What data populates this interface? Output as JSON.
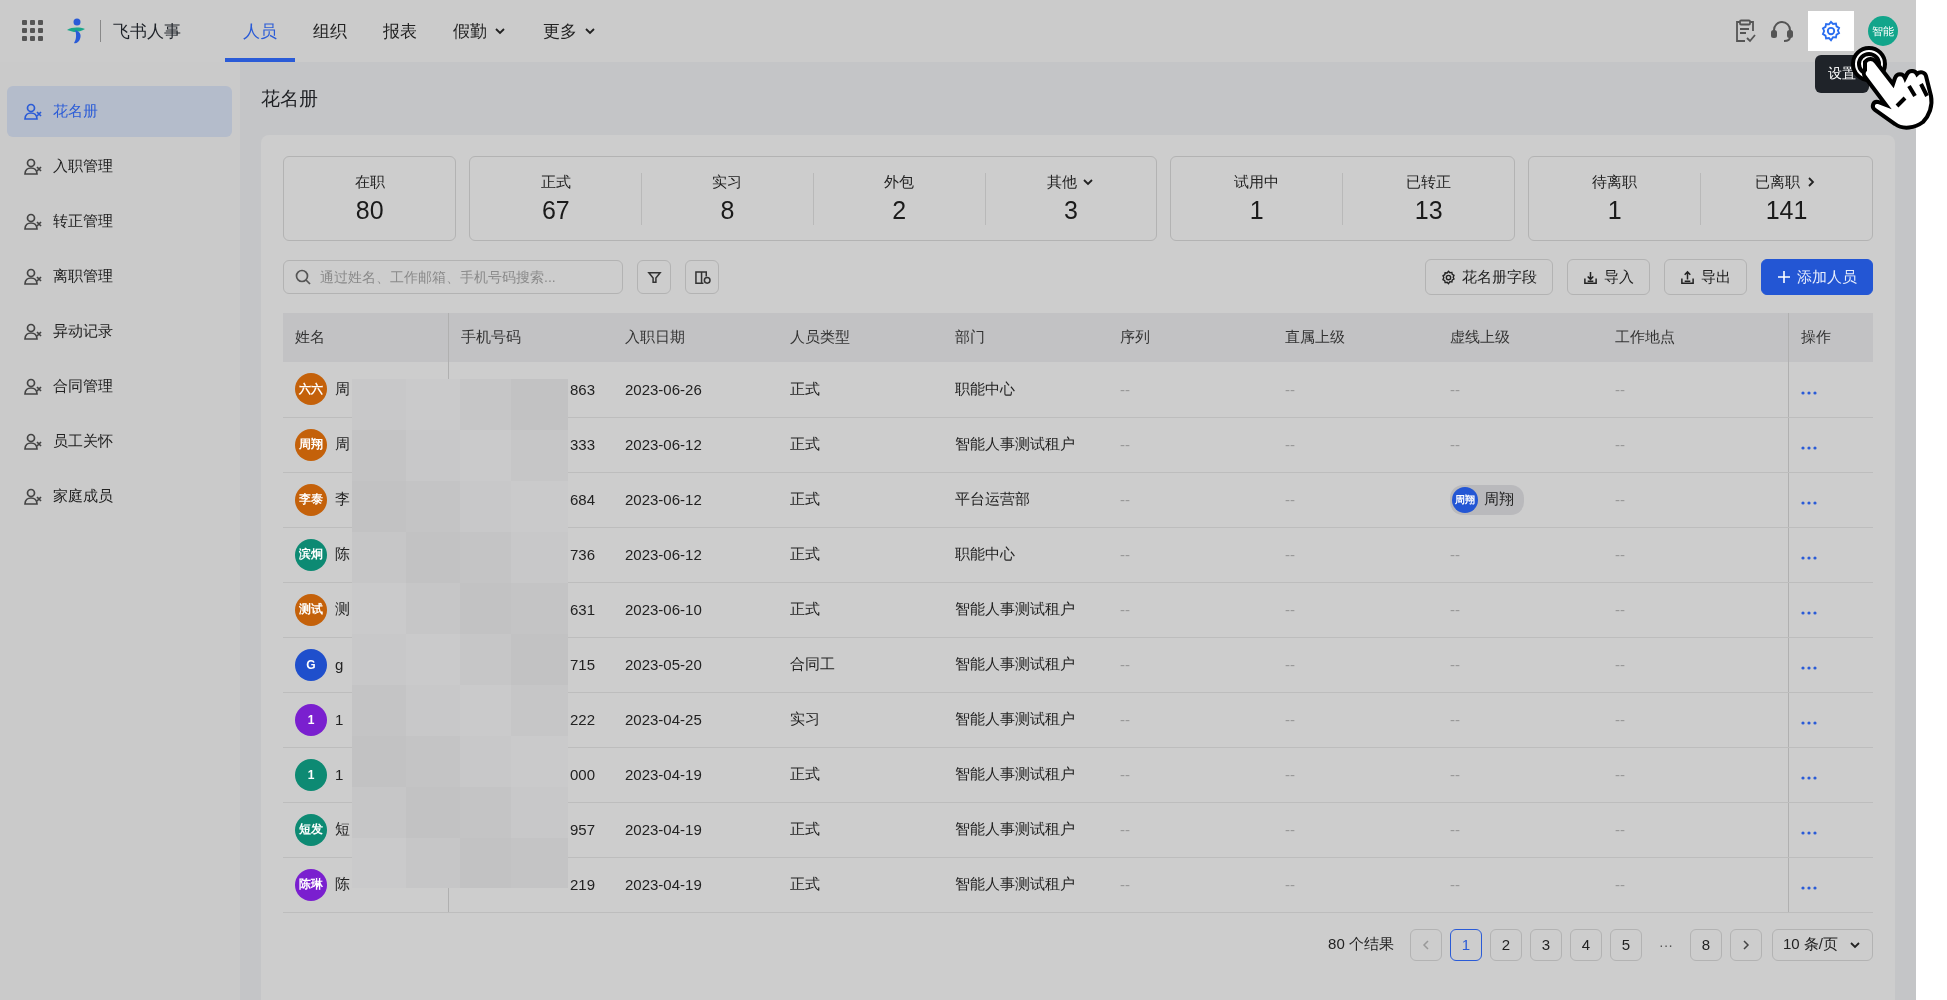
{
  "topbar": {
    "app_name": "飞书人事",
    "nav": [
      {
        "label": "人员",
        "selected": true,
        "dropdown": false
      },
      {
        "label": "组织",
        "selected": false,
        "dropdown": false
      },
      {
        "label": "报表",
        "selected": false,
        "dropdown": false
      },
      {
        "label": "假勤",
        "selected": false,
        "dropdown": true
      },
      {
        "label": "更多",
        "selected": false,
        "dropdown": true
      }
    ],
    "user_avatar": "智能",
    "tooltip": "设置"
  },
  "sidebar": {
    "items": [
      {
        "label": "花名册",
        "selected": true
      },
      {
        "label": "入职管理",
        "selected": false
      },
      {
        "label": "转正管理",
        "selected": false
      },
      {
        "label": "离职管理",
        "selected": false
      },
      {
        "label": "异动记录",
        "selected": false
      },
      {
        "label": "合同管理",
        "selected": false
      },
      {
        "label": "员工关怀",
        "selected": false
      },
      {
        "label": "家庭成员",
        "selected": false
      }
    ]
  },
  "page_title": "花名册",
  "stats": [
    {
      "cells": [
        {
          "label": "在职",
          "value": "80",
          "dropdown": false,
          "link": false
        }
      ]
    },
    {
      "cells": [
        {
          "label": "正式",
          "value": "67",
          "dropdown": false,
          "link": false
        },
        {
          "label": "实习",
          "value": "8",
          "dropdown": false,
          "link": false
        },
        {
          "label": "外包",
          "value": "2",
          "dropdown": false,
          "link": false
        },
        {
          "label": "其他",
          "value": "3",
          "dropdown": true,
          "link": false
        }
      ]
    },
    {
      "cells": [
        {
          "label": "试用中",
          "value": "1",
          "dropdown": false,
          "link": false
        },
        {
          "label": "已转正",
          "value": "13",
          "dropdown": false,
          "link": false
        }
      ]
    },
    {
      "cells": [
        {
          "label": "待离职",
          "value": "1",
          "dropdown": false,
          "link": false
        },
        {
          "label": "已离职",
          "value": "141",
          "dropdown": false,
          "link": true
        }
      ]
    }
  ],
  "toolbar": {
    "search": {
      "placeholder": "通过姓名、工作邮箱、手机号码搜索..."
    },
    "buttons": [
      {
        "kind": "settings",
        "label": "花名册字段"
      },
      {
        "kind": "import",
        "label": "导入"
      },
      {
        "kind": "export",
        "label": "导出"
      },
      {
        "kind": "add",
        "label": "添加人员"
      }
    ]
  },
  "table": {
    "columns": [
      "姓名",
      "手机号码",
      "入职日期",
      "人员类型",
      "部门",
      "序列",
      "直属上级",
      "虚线上级",
      "工作地点",
      "操作"
    ],
    "rows": [
      {
        "avatar": "六六",
        "color": "#c4610a",
        "name": "周",
        "phone": "863",
        "hire_date": "2023-06-26",
        "type": "正式",
        "department": "职能中心",
        "sequence": "--",
        "manager": "--",
        "dotted_manager": "--",
        "location": "--"
      },
      {
        "avatar": "周翔",
        "color": "#c4610a",
        "name": "周",
        "phone": "333",
        "hire_date": "2023-06-12",
        "type": "正式",
        "department": "智能人事测试租户",
        "sequence": "--",
        "manager": "--",
        "dotted_manager": "--",
        "location": "--"
      },
      {
        "avatar": "李泰",
        "color": "#c4610a",
        "name": "李",
        "phone": "684",
        "hire_date": "2023-06-12",
        "type": "正式",
        "department": "平台运营部",
        "sequence": "--",
        "manager": "--",
        "dotted_manager_chip": {
          "avatar": "周翔",
          "name": "周翔"
        },
        "location": "--"
      },
      {
        "avatar": "滨炯",
        "color": "#0d8a73",
        "name": "陈",
        "phone": "736",
        "hire_date": "2023-06-12",
        "type": "正式",
        "department": "职能中心",
        "sequence": "--",
        "manager": "--",
        "dotted_manager": "--",
        "location": "--"
      },
      {
        "avatar": "测试",
        "color": "#c4610a",
        "name": "测",
        "phone": "631",
        "hire_date": "2023-06-10",
        "type": "正式",
        "department": "智能人事测试租户",
        "sequence": "--",
        "manager": "--",
        "dotted_manager": "--",
        "location": "--"
      },
      {
        "avatar": "G",
        "color": "#1f4fcc",
        "name": "g",
        "phone": "715",
        "hire_date": "2023-05-20",
        "type": "合同工",
        "department": "智能人事测试租户",
        "sequence": "--",
        "manager": "--",
        "dotted_manager": "--",
        "location": "--"
      },
      {
        "avatar": "1",
        "color": "#7a1fcf",
        "name": "1",
        "phone": "222",
        "hire_date": "2023-04-25",
        "type": "实习",
        "department": "智能人事测试租户",
        "sequence": "--",
        "manager": "--",
        "dotted_manager": "--",
        "location": "--"
      },
      {
        "avatar": "1",
        "color": "#0d8a73",
        "name": "1",
        "phone": "000",
        "hire_date": "2023-04-19",
        "type": "正式",
        "department": "智能人事测试租户",
        "sequence": "--",
        "manager": "--",
        "dotted_manager": "--",
        "location": "--"
      },
      {
        "avatar": "短发",
        "color": "#0d8a73",
        "name": "短",
        "phone": "957",
        "hire_date": "2023-04-19",
        "type": "正式",
        "department": "智能人事测试租户",
        "sequence": "--",
        "manager": "--",
        "dotted_manager": "--",
        "location": "--"
      },
      {
        "avatar": "陈琳",
        "color": "#7a1fcf",
        "name": "陈",
        "phone": "219",
        "hire_date": "2023-04-19",
        "type": "正式",
        "department": "智能人事测试租户",
        "sequence": "--",
        "manager": "--",
        "dotted_manager": "--",
        "location": "--"
      }
    ]
  },
  "pagination": {
    "total": "80 个结果",
    "pages": [
      {
        "label": "1",
        "kind": "page",
        "selected": true
      },
      {
        "label": "2",
        "kind": "page",
        "selected": false
      },
      {
        "label": "3",
        "kind": "page",
        "selected": false
      },
      {
        "label": "4",
        "kind": "page",
        "selected": false
      },
      {
        "label": "5",
        "kind": "page",
        "selected": false
      },
      {
        "label": "···",
        "kind": "ellipsis",
        "selected": false
      },
      {
        "label": "8",
        "kind": "page",
        "selected": false
      }
    ],
    "page_size": "10 条/页"
  }
}
